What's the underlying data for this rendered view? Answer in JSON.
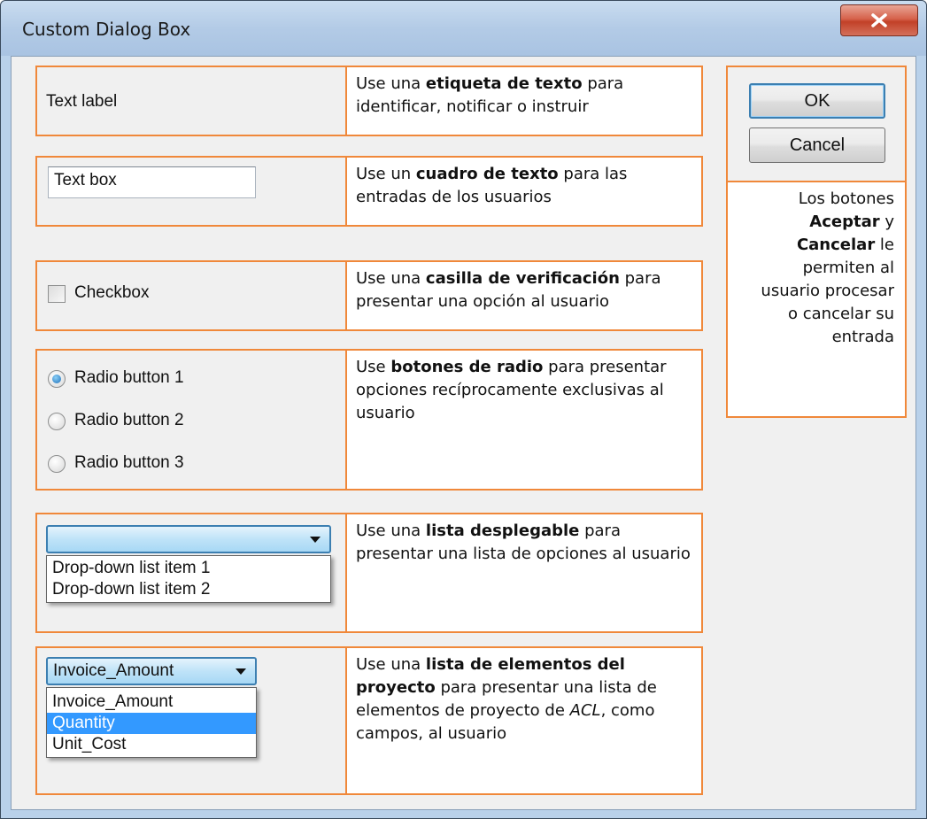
{
  "window": {
    "title": "Custom Dialog Box",
    "close_label": "x"
  },
  "sections": {
    "label": {
      "control_text": "Text label",
      "desc_pre": "Use una ",
      "desc_bold": "etiqueta de texto",
      "desc_post": " para identificar, notificar o instruir"
    },
    "textbox": {
      "value": "Text box",
      "desc_pre": "Use un ",
      "desc_bold": "cuadro de texto",
      "desc_post": " para las entradas de los usuarios"
    },
    "checkbox": {
      "label": "Checkbox",
      "checked": false,
      "desc_pre": "Use una ",
      "desc_bold": "casilla de verificación",
      "desc_post": " para presentar una opción al usuario"
    },
    "radio": {
      "options": [
        "Radio button 1",
        "Radio button 2",
        "Radio button 3"
      ],
      "selected_index": 0,
      "desc_pre": "Use ",
      "desc_bold": "botones de radio",
      "desc_post": " para presentar opciones recíprocamente exclusivas al usuario"
    },
    "dropdown": {
      "selected": "",
      "items": [
        "Drop-down list item 1",
        "Drop-down list item 2"
      ],
      "desc_pre": "Use una ",
      "desc_bold": "lista desplegable",
      "desc_post": " para presentar una  lista de opciones al usuario"
    },
    "project_list": {
      "selected": "Invoice_Amount",
      "items": [
        "Invoice_Amount",
        "Quantity",
        "Unit_Cost"
      ],
      "highlighted_index": 1,
      "desc_pre": "Use una ",
      "desc_bold": "lista de elementos del proyecto",
      "desc_mid": " para presentar una  lista de elementos de proyecto de ",
      "desc_italic": "ACL",
      "desc_post": ", como campos, al usuario"
    }
  },
  "buttons": {
    "ok_label": "OK",
    "cancel_label": "Cancel",
    "desc_pre": "Los botones ",
    "desc_bold1": "Aceptar",
    "desc_mid1": " y ",
    "desc_bold2": "Cancelar",
    "desc_post": " le permiten al usuario procesar o cancelar su entrada"
  },
  "colors": {
    "callout_border": "#f0883a",
    "highlight": "#3399ff",
    "dialog_bg": "#f0f0f0"
  }
}
